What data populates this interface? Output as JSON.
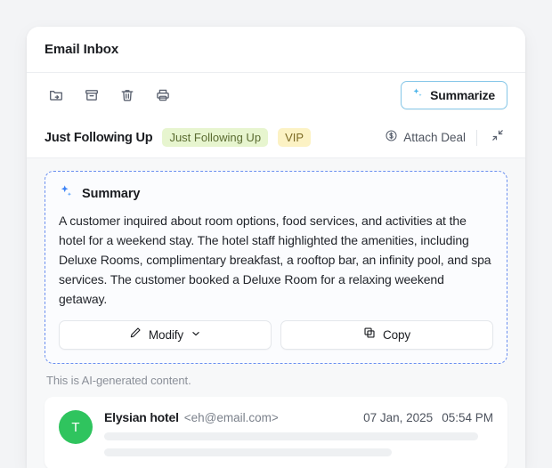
{
  "window": {
    "title": "Email Inbox"
  },
  "toolbar": {
    "icons": [
      {
        "name": "move-to-folder-icon",
        "label": "Move to folder"
      },
      {
        "name": "archive-icon",
        "label": "Archive"
      },
      {
        "name": "trash-icon",
        "label": "Delete"
      },
      {
        "name": "print-icon",
        "label": "Print"
      }
    ],
    "summarize_label": "Summarize",
    "summarize_icon": "sparkle-icon",
    "summarize_border_color": "#86c7e8"
  },
  "subject": {
    "title": "Just Following Up",
    "tags": [
      {
        "label": "Just Following Up",
        "bg": "#e7f5cf",
        "fg": "#5a6b30"
      },
      {
        "label": "VIP",
        "bg": "#fcf2c4",
        "fg": "#7c6a24"
      }
    ],
    "attach_deal_label": "Attach Deal",
    "attach_deal_icon": "dollar-circle-icon",
    "collapse_icon": "collapse-arrows-icon"
  },
  "summary": {
    "icon": "sparkle-icon",
    "title": "Summary",
    "accent_color": "#6a8ff0",
    "text": "A customer inquired about room options, food services, and activities at the hotel for a weekend stay. The hotel staff highlighted the amenities, including Deluxe Rooms, complimentary breakfast, a rooftop bar, an infinity pool, and spa services. The customer booked a Deluxe Room for a relaxing weekend getaway.",
    "modify_label": "Modify",
    "modify_icon": "pencil-icon",
    "modify_chevron_icon": "chevron-down-icon",
    "copy_label": "Copy",
    "copy_icon": "copy-icon",
    "ai_note": "This is AI-generated content."
  },
  "email": {
    "avatar_initial": "T",
    "avatar_color": "#2fc45e",
    "sender_name": "Elysian hotel",
    "sender_email": "<eh@email.com>",
    "date": "07 Jan, 2025",
    "time": "05:54 PM"
  }
}
